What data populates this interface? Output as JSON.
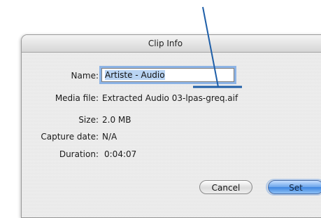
{
  "dialog": {
    "title": "Clip Info",
    "fields": {
      "name_label": "Name:",
      "name_value": "Artiste - Audio",
      "media_label": "Media file:",
      "media_value": "Extracted Audio 03-lpas-greq.aif",
      "size_label": "Size:",
      "size_value": "2.0 MB",
      "capture_label": "Capture date:",
      "capture_value": "N/A",
      "duration_label": "Duration:",
      "duration_value": "0:04:07"
    },
    "buttons": {
      "cancel": "Cancel",
      "set": "Set"
    }
  },
  "colors": {
    "focus_ring": "#8db4e6",
    "default_button": "#3e86e0",
    "annotation_line": "#1f5fa8"
  }
}
